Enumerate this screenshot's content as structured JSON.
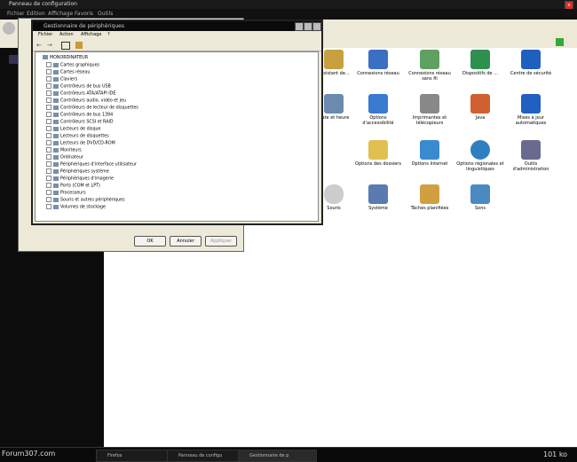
{
  "control_panel": {
    "title": "Panneau de configuration",
    "menu": [
      "Fichier",
      "Edition",
      "Affichage",
      "Favoris",
      "Outils"
    ],
    "icons": [
      {
        "label": "Assistant de...",
        "color": "#c8a040"
      },
      {
        "label": "Connexions réseau",
        "color": "#3a6fc4"
      },
      {
        "label": "Connexions réseau sans fil",
        "color": "#60a060"
      },
      {
        "label": "Dispositifs de ...",
        "color": "#2f8f4f"
      },
      {
        "label": "Centre de sécurité",
        "color": "#1f5fbf"
      },
      {
        "label": "Date et heure",
        "color": "#6a8ab0"
      },
      {
        "label": "Options d'accessibilité",
        "color": "#3a7ad0"
      },
      {
        "label": "Imprimantes et télécopieurs",
        "color": "#888"
      },
      {
        "label": "Java",
        "color": "#d06030"
      },
      {
        "label": "Mises à jour automatiques",
        "color": "#2060c0"
      },
      {
        "label": "Options des dossiers",
        "color": "#e0c050"
      },
      {
        "label": "Options Internet",
        "color": "#3a8ad0"
      },
      {
        "label": "Options régionales et linguistiques",
        "color": "#2f7fc0"
      },
      {
        "label": "Outils d'administration",
        "color": "#6a6a90"
      },
      {
        "label": "Souris",
        "color": "#aaa"
      },
      {
        "label": "Système",
        "color": "#5a7ab0"
      },
      {
        "label": "Tâches planifiées",
        "color": "#d0a040"
      },
      {
        "label": "Sons",
        "color": "#4a8ac0"
      }
    ]
  },
  "properties_dialog": {
    "ok": "OK",
    "cancel": "Annuler",
    "apply": "Appliquer"
  },
  "device_manager": {
    "title": "Gestionnaire de périphériques",
    "menu": [
      "Fichier",
      "Action",
      "Affichage",
      "?"
    ],
    "root": "MONORDINATEUR",
    "items": [
      "Cartes graphiques",
      "Cartes réseau",
      "Claviers",
      "Contrôleurs de bus USB",
      "Contrôleurs ATA/ATAPI IDE",
      "Contrôleurs audio, vidéo et jeu",
      "Contrôleurs de lecteur de disquettes",
      "Contrôleurs de bus 1394",
      "Contrôleurs SCSI et RAID",
      "Lecteurs de disque",
      "Lecteurs de disquettes",
      "Lecteurs de DVD/CD-ROM",
      "Moniteurs",
      "Ordinateur",
      "Périphériques d'interface utilisateur",
      "Périphériques système",
      "Périphériques d'imagerie",
      "Ports (COM et LPT)",
      "Processeurs",
      "Souris et autres périphériques",
      "Volumes de stockage"
    ]
  },
  "taskbar": {
    "start": "Forum307.com",
    "tasks": [
      "Firefox",
      "Panneau de configu",
      "Gestionnaire de p"
    ],
    "clock": "101 ko"
  }
}
